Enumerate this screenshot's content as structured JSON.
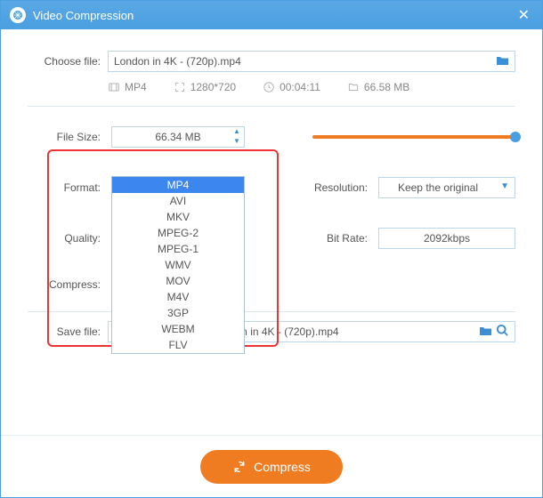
{
  "window": {
    "title": "Video Compression"
  },
  "choose": {
    "label": "Choose file:",
    "value": "London in 4K - (720p).mp4"
  },
  "meta": {
    "container": "MP4",
    "resolution": "1280*720",
    "duration": "00:04:11",
    "size": "66.58 MB"
  },
  "filesize": {
    "label": "File Size:",
    "value": "66.34 MB"
  },
  "format": {
    "label": "Format:",
    "value": "MP4",
    "options": [
      "MP4",
      "AVI",
      "MKV",
      "MPEG-2",
      "MPEG-1",
      "WMV",
      "MOV",
      "M4V",
      "3GP",
      "WEBM",
      "FLV"
    ],
    "selected": "MP4"
  },
  "quality": {
    "label": "Quality:"
  },
  "compress": {
    "label": "Compress:"
  },
  "resolution": {
    "label": "Resolution:",
    "value": "Keep the original"
  },
  "bitrate": {
    "label": "Bit Rate:",
    "value": "2092kbps"
  },
  "save": {
    "label": "Save file:",
    "value": "C:\\Users\\HP\\Videos\\London in 4K - (720p).mp4"
  },
  "action": {
    "compress": "Compress"
  }
}
